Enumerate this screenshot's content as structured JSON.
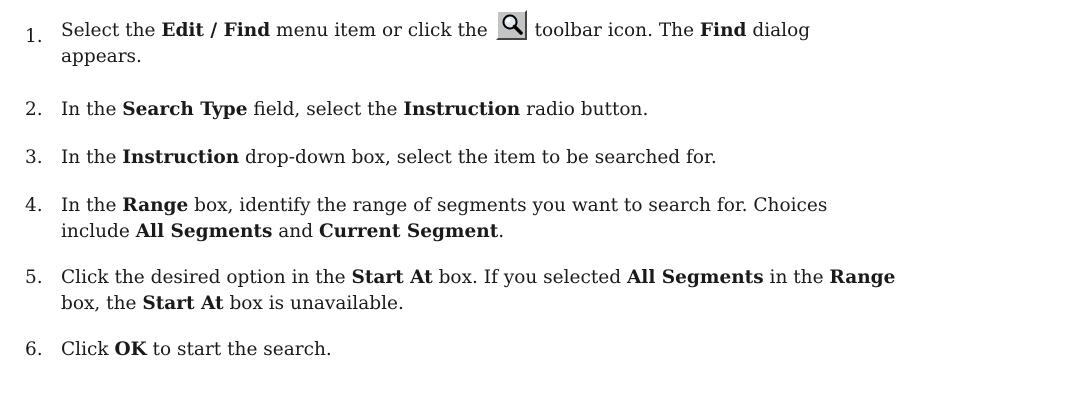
{
  "steps": [
    {
      "number": "1.",
      "text_1": "Select the ",
      "bold_1": "Edit / Find",
      "text_2": " menu item or click the ",
      "icon": "find-magnifier-icon",
      "text_3": " toolbar icon. The ",
      "bold_2": "Find",
      "text_4": " dialog",
      "text_5": "appears."
    },
    {
      "number": "2.",
      "text_1": "In the ",
      "bold_1": "Search Type",
      "text_2": " field, select the ",
      "bold_2": "Instruction",
      "text_3": " radio button."
    },
    {
      "number": "3.",
      "text_1": "In the ",
      "bold_1": "Instruction",
      "text_2": " drop-down box, select the item to be searched for."
    },
    {
      "number": "4.",
      "text_1": "In the ",
      "bold_1": "Range",
      "text_2": " box, identify the range of segments you want to search for. Choices",
      "text_3": "include ",
      "bold_2": "All Segments",
      "text_4": " and ",
      "bold_3": "Current Segment",
      "text_5": "."
    },
    {
      "number": "5.",
      "text_1": "Click the desired option in the ",
      "bold_1": "Start At",
      "text_2": " box. If you selected ",
      "bold_2": "All Segments",
      "text_3": " in the ",
      "bold_3": "Range",
      "text_4": "box, the ",
      "bold_4": "Start At",
      "text_5": " box is unavailable."
    },
    {
      "number": "6.",
      "text_1": "Click ",
      "bold_1": "OK",
      "text_2": " to start the search."
    }
  ]
}
